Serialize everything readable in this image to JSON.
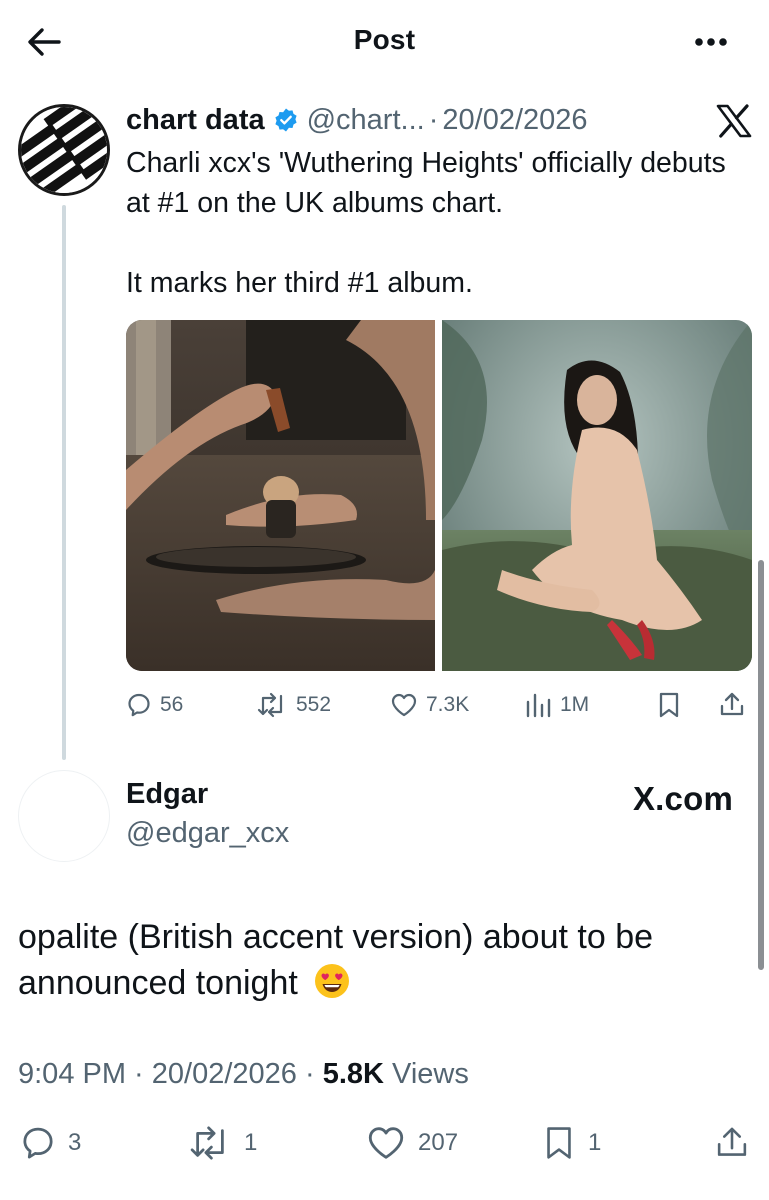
{
  "header": {
    "title": "Post",
    "back_icon": "arrow-left-icon",
    "more_icon": "ellipsis-icon"
  },
  "quoted_post": {
    "author_name": "chart data",
    "handle": "@chart...",
    "separator": "·",
    "date": "20/02/2026",
    "verified_color": "#1d9bf0",
    "text_line_1": "Charli xcx's 'Wuthering Heights' officially debuts at #1 on the UK albums chart.",
    "text_line_2": "It marks her third #1 album.",
    "actions": {
      "replies": "56",
      "reposts": "552",
      "likes": "7.3K",
      "views": "1M"
    }
  },
  "main_post": {
    "author_name": "Edgar",
    "handle": "@edgar_xcx",
    "watermark": "X.com",
    "text": "opalite (British accent version) about to be announced tonight",
    "emoji": "smiling-face-with-heart-eyes",
    "meta": {
      "time": "9:04 PM",
      "separator_1": " · ",
      "date": "20/02/2026",
      "separator_2": " · ",
      "views_count": "5.8K",
      "views_label": " Views"
    },
    "actions": {
      "replies": "3",
      "reposts": "1",
      "likes": "207",
      "bookmarks": "1"
    }
  },
  "colors": {
    "text": "#0f1419",
    "secondary": "#536471",
    "accent": "#1d9bf0"
  }
}
